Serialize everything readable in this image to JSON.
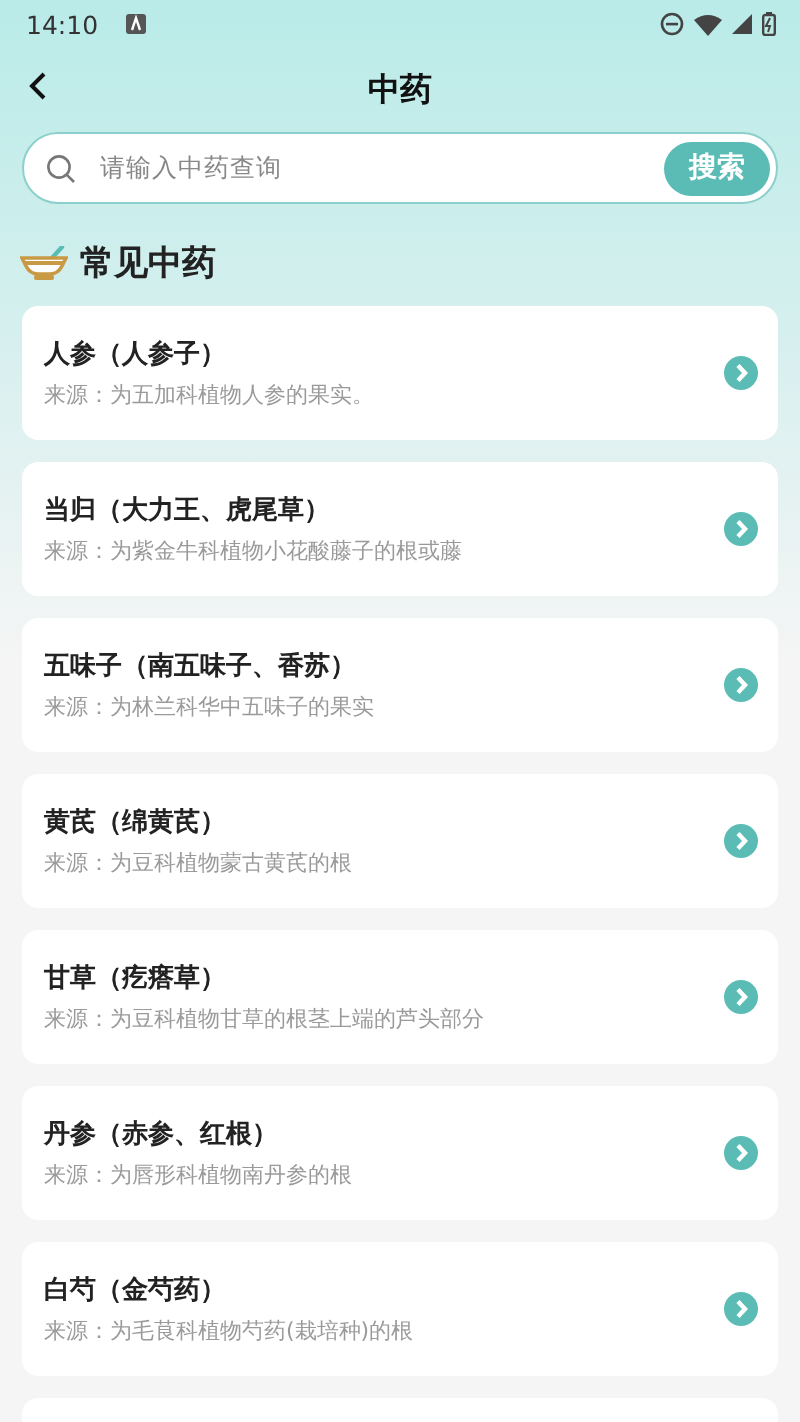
{
  "status_bar": {
    "time": "14:10"
  },
  "header": {
    "title": "中药"
  },
  "search": {
    "placeholder": "请输入中药查询",
    "button": "搜索"
  },
  "section": {
    "title": "常见中药"
  },
  "items": [
    {
      "name": "人参（人参子）",
      "source": "来源：为五加科植物人参的果实。"
    },
    {
      "name": "当归（大力王、虎尾草）",
      "source": "来源：为紫金牛科植物小花酸藤子的根或藤"
    },
    {
      "name": "五味子（南五味子、香苏）",
      "source": "来源：为林兰科华中五味子的果实"
    },
    {
      "name": "黄芪（绵黄芪）",
      "source": "来源：为豆科植物蒙古黄芪的根"
    },
    {
      "name": "甘草（疙瘩草）",
      "source": "来源：为豆科植物甘草的根茎上端的芦头部分"
    },
    {
      "name": "丹参（赤参、红根）",
      "source": "来源：为唇形科植物南丹参的根"
    },
    {
      "name": "白芍（金芍药）",
      "source": "来源：为毛茛科植物芍药(栽培种)的根"
    }
  ]
}
